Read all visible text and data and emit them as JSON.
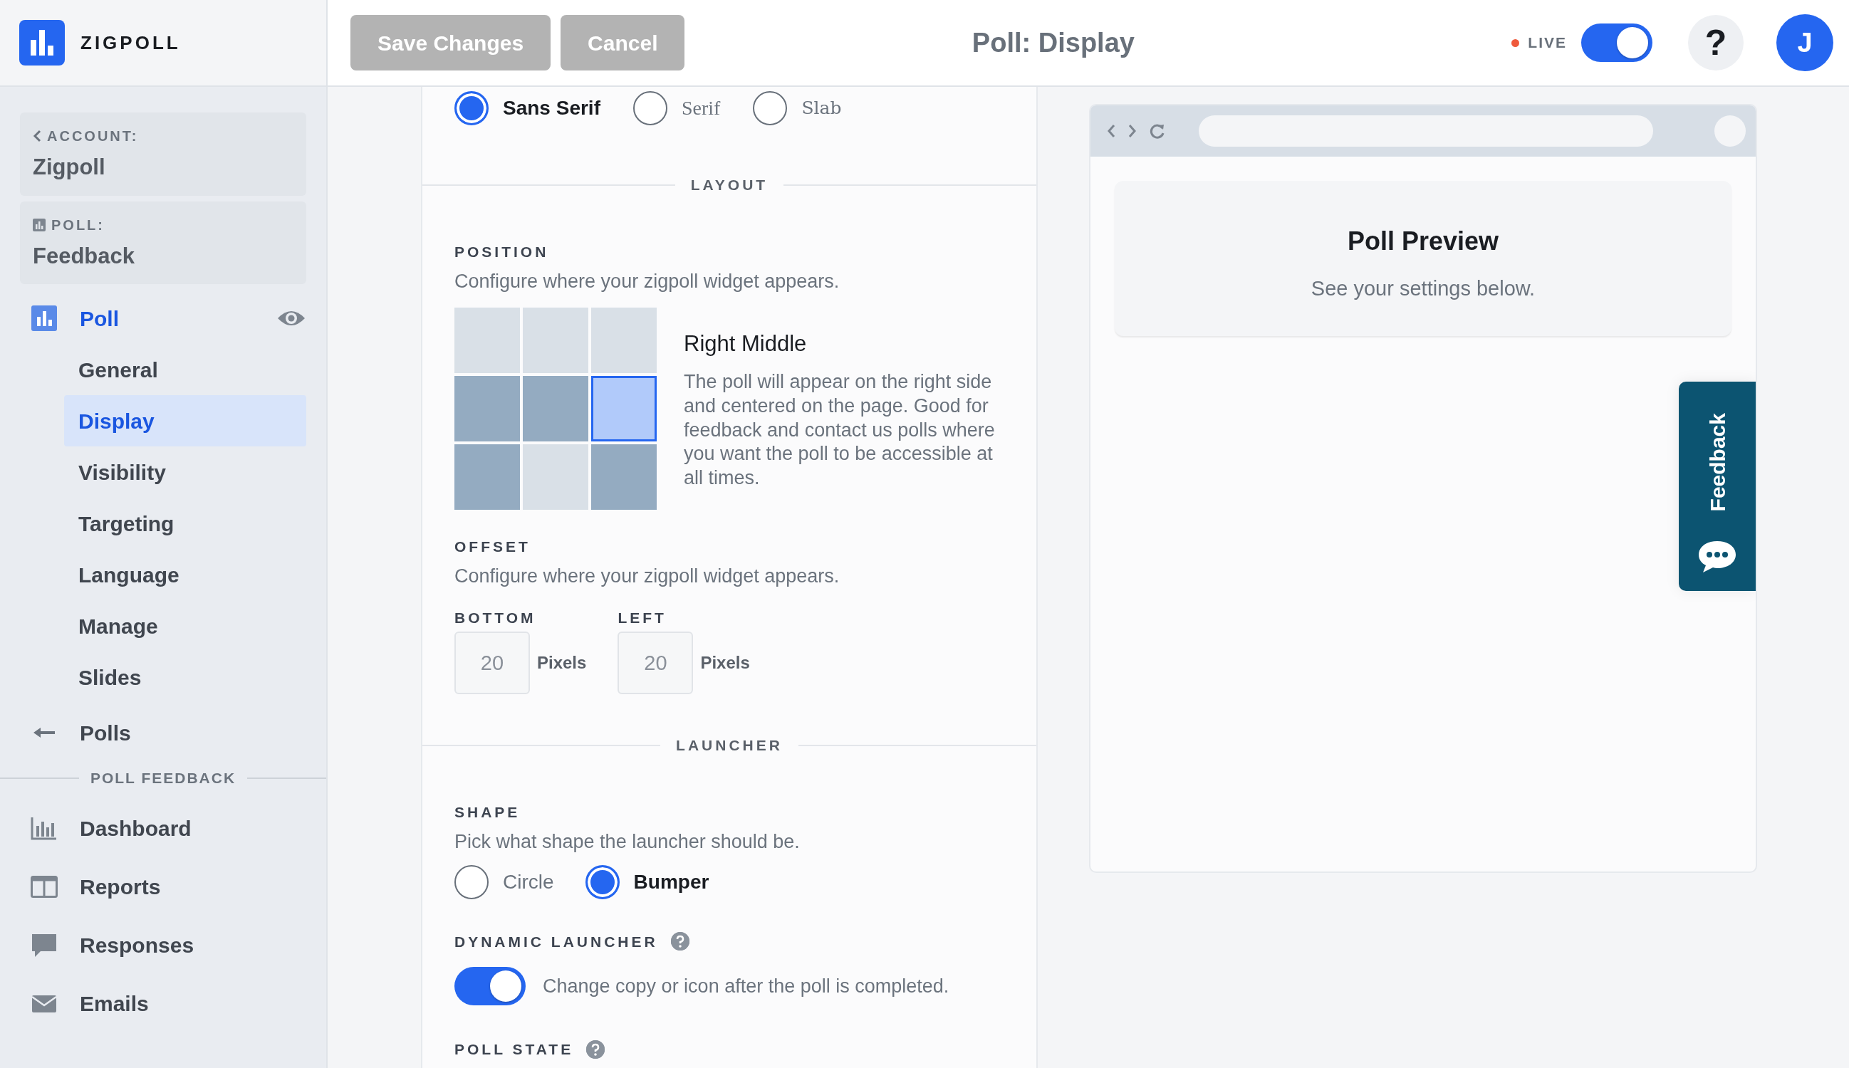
{
  "brand": {
    "name": "ZIGPOLL"
  },
  "header": {
    "buttons": [
      {
        "label": "Save Changes",
        "disabled": true
      },
      {
        "label": "Cancel",
        "disabled": true
      }
    ],
    "title": "Poll: Display",
    "live": {
      "label": "LIVE",
      "on": true
    },
    "help": "?",
    "avatar": "J"
  },
  "sidebar": {
    "context": [
      {
        "kind": "account",
        "label": "ACCOUNT:",
        "value": "Zigpoll"
      },
      {
        "kind": "poll",
        "label": "POLL:",
        "value": "Feedback"
      }
    ],
    "poll_item": {
      "label": "Poll",
      "selected": true
    },
    "sub_items": [
      {
        "label": "General",
        "selected": false
      },
      {
        "label": "Display",
        "selected": true
      },
      {
        "label": "Visibility",
        "selected": false
      },
      {
        "label": "Targeting",
        "selected": false
      },
      {
        "label": "Language",
        "selected": false
      },
      {
        "label": "Manage",
        "selected": false
      },
      {
        "label": "Slides",
        "selected": false
      }
    ],
    "back_item": {
      "label": "Polls"
    },
    "section": "POLL FEEDBACK",
    "items": [
      {
        "kind": "chart",
        "label": "Dashboard"
      },
      {
        "kind": "columns",
        "label": "Reports"
      },
      {
        "kind": "bubble",
        "label": "Responses"
      },
      {
        "kind": "mail",
        "label": "Emails"
      }
    ]
  },
  "settings": {
    "fonts": [
      {
        "kind": "sans",
        "label": "Sans Serif",
        "selected": true
      },
      {
        "kind": "serif",
        "label": "Serif",
        "selected": false
      },
      {
        "kind": "slab",
        "label": "Slab",
        "selected": false
      }
    ],
    "layout": {
      "heading": "LAYOUT",
      "position": {
        "label": "POSITION",
        "description": "Configure where your zigpoll widget appears.",
        "cells": [
          {
            "available": false,
            "selected": false
          },
          {
            "available": false,
            "selected": false
          },
          {
            "available": false,
            "selected": false
          },
          {
            "available": true,
            "selected": false
          },
          {
            "available": true,
            "selected": false
          },
          {
            "available": true,
            "selected": true
          },
          {
            "available": true,
            "selected": false
          },
          {
            "available": false,
            "selected": false
          },
          {
            "available": true,
            "selected": false
          }
        ],
        "choice_title": "Right Middle",
        "choice_description": "The poll will appear on the right side and centered on the page. Good for feedback and contact us polls where you want the poll to be accessible at all times."
      },
      "offset": {
        "label": "OFFSET",
        "description": "Configure where your zigpoll widget appears.",
        "fields": [
          {
            "label": "BOTTOM",
            "placeholder": "20",
            "unit": "Pixels"
          },
          {
            "label": "LEFT",
            "placeholder": "20",
            "unit": "Pixels"
          }
        ]
      }
    },
    "launcher": {
      "heading": "LAUNCHER",
      "shape": {
        "label": "SHAPE",
        "description": "Pick what shape the launcher should be.",
        "options": [
          {
            "label": "Circle",
            "selected": false
          },
          {
            "label": "Bumper",
            "selected": true
          }
        ]
      },
      "dynamic": {
        "label": "DYNAMIC LAUNCHER",
        "on": true,
        "description": "Change copy or icon after the poll is completed."
      },
      "poll_state": {
        "label": "POLL STATE"
      }
    }
  },
  "preview": {
    "title": "Poll Preview",
    "subtitle": "See your settings below.",
    "launcher_label": "Feedback"
  }
}
